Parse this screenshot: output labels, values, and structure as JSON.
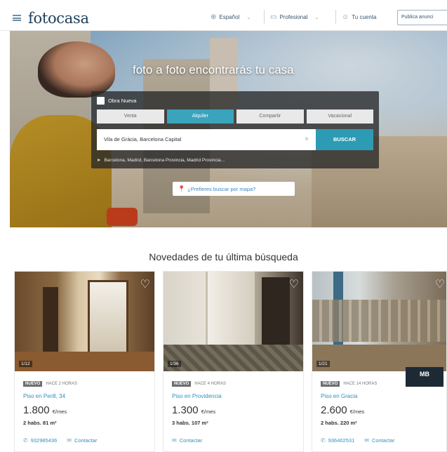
{
  "header": {
    "logo": "fotocasa",
    "language": "Español",
    "professional": "Profesional",
    "account": "Tu cuenta",
    "publish": "Publica anunci"
  },
  "hero": {
    "title": "foto a foto encontrarás tu casa",
    "new_build_label": "Obra Nueva",
    "tabs": [
      {
        "label": "Venta",
        "active": false
      },
      {
        "label": "Alquiler",
        "active": true
      },
      {
        "label": "Compartir",
        "active": false
      },
      {
        "label": "Vacacional",
        "active": false
      }
    ],
    "search_value": "Vila de Gràcia, Barcelona Capital",
    "search_button": "BUSCAR",
    "suggestions": "Barcelona, Madrid, Barcelona Provincia, Madrid Provincia...",
    "map_link": "¿Prefieres buscar por mapa?"
  },
  "section": {
    "title": "Novedades de tu última búsqueda"
  },
  "listings": [
    {
      "photo_count": "1/12",
      "badge": "NUEVO",
      "ago": "HACE 2 HORAS",
      "title": "Piso en Perill, 34",
      "price": "1.800",
      "price_unit": "€/mes",
      "details": "2 habs. 81 m²",
      "phone": "932985436",
      "contact": "Contactar"
    },
    {
      "photo_count": "1/36",
      "badge": "NUEVO",
      "ago": "HACE 4 HORAS",
      "title": "Piso en Providencia",
      "price": "1.300",
      "price_unit": "€/mes",
      "details": "3 habs. 107 m²",
      "phone": "",
      "contact": "Contactar"
    },
    {
      "photo_count": "1/21",
      "badge": "NUEVO",
      "ago": "HACE 14 HORAS",
      "title": "Piso en Gracia",
      "price": "2.600",
      "price_unit": "€/mes",
      "details": "2 habs. 220 m²",
      "phone": "936402531",
      "contact": "Contactar",
      "agency_logo_text": "MB"
    }
  ],
  "colors": {
    "brand": "#1c3d5a",
    "accent": "#3aa4bd",
    "link": "#2f8fbf"
  }
}
